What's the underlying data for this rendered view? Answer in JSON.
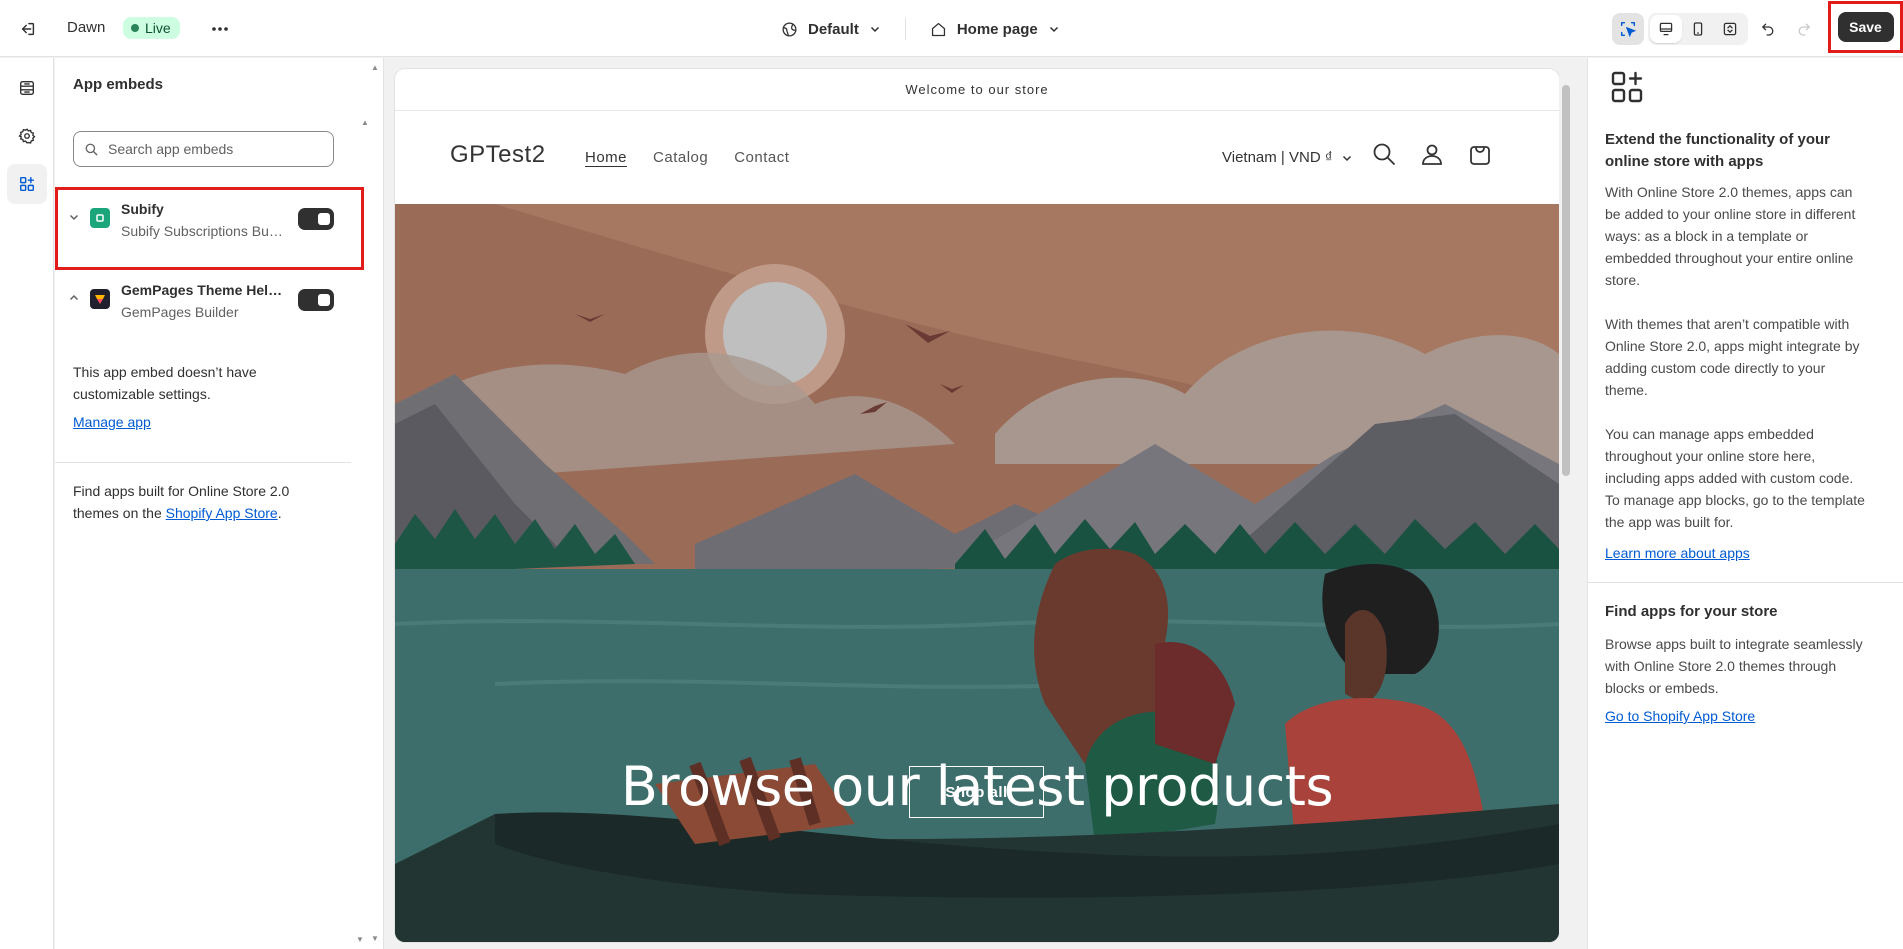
{
  "topbar": {
    "theme_name": "Dawn",
    "live_label": "Live",
    "more_label": "•••",
    "locale_dropdown": "Default",
    "page_dropdown": "Home page",
    "save_label": "Save"
  },
  "sidebar": {
    "title": "App embeds",
    "search_placeholder": "Search app embeds",
    "embeds": [
      {
        "name": "Subify",
        "subtitle": "Subify Subscriptions Buy Box",
        "enabled": true,
        "icon_color": "#1aa67a"
      },
      {
        "name": "GemPages Theme Helper",
        "subtitle": "GemPages Builder",
        "enabled": true,
        "icon_color": "#1f1f2e"
      }
    ],
    "no_settings_text": "This app embed doesn’t have customizable settings.",
    "manage_app_link": "Manage app",
    "find_apps_text_1": "Find apps built for Online Store 2.0 themes on the ",
    "find_apps_link": "Shopify App Store",
    "find_apps_text_2": "."
  },
  "preview": {
    "announcement": "Welcome to our store",
    "store_name": "GPTest2",
    "nav": [
      "Home",
      "Catalog",
      "Contact"
    ],
    "locale": "Vietnam | VND ₫",
    "hero_title": "Browse our latest products",
    "hero_button": "Shop all"
  },
  "right_panel": {
    "heading": "Extend the functionality of your online store with apps",
    "para1": "With Online Store 2.0 themes, apps can be added to your online store in different ways: as a block in a template or embedded throughout your entire online store.",
    "para2": "With themes that aren’t compatible with Online Store 2.0, apps might integrate by adding custom code directly to your theme.",
    "para3": "You can manage apps embedded throughout your online store here, including apps added with custom code. To manage app blocks, go to the template the app was built for.",
    "learn_link": "Learn more about apps",
    "find_heading": "Find apps for your store",
    "find_para": "Browse apps built to integrate seamlessly with Online Store 2.0 themes through blocks or embeds.",
    "store_link": "Go to Shopify App Store"
  },
  "colors": {
    "accent_link": "#005bd3",
    "highlight": "#e21b1b",
    "save_bg": "#303030",
    "live_bg": "#cdfee1"
  },
  "icons": [
    "exit-icon",
    "globe-icon",
    "home-icon",
    "select-icon",
    "desktop-icon",
    "mobile-icon",
    "fullscreen-icon",
    "undo-icon",
    "redo-icon",
    "sections-icon",
    "settings-icon",
    "app-embeds-icon",
    "search-icon",
    "chevron-down-icon",
    "chevron-up-icon",
    "user-icon",
    "cart-icon",
    "apps-add-icon"
  ]
}
